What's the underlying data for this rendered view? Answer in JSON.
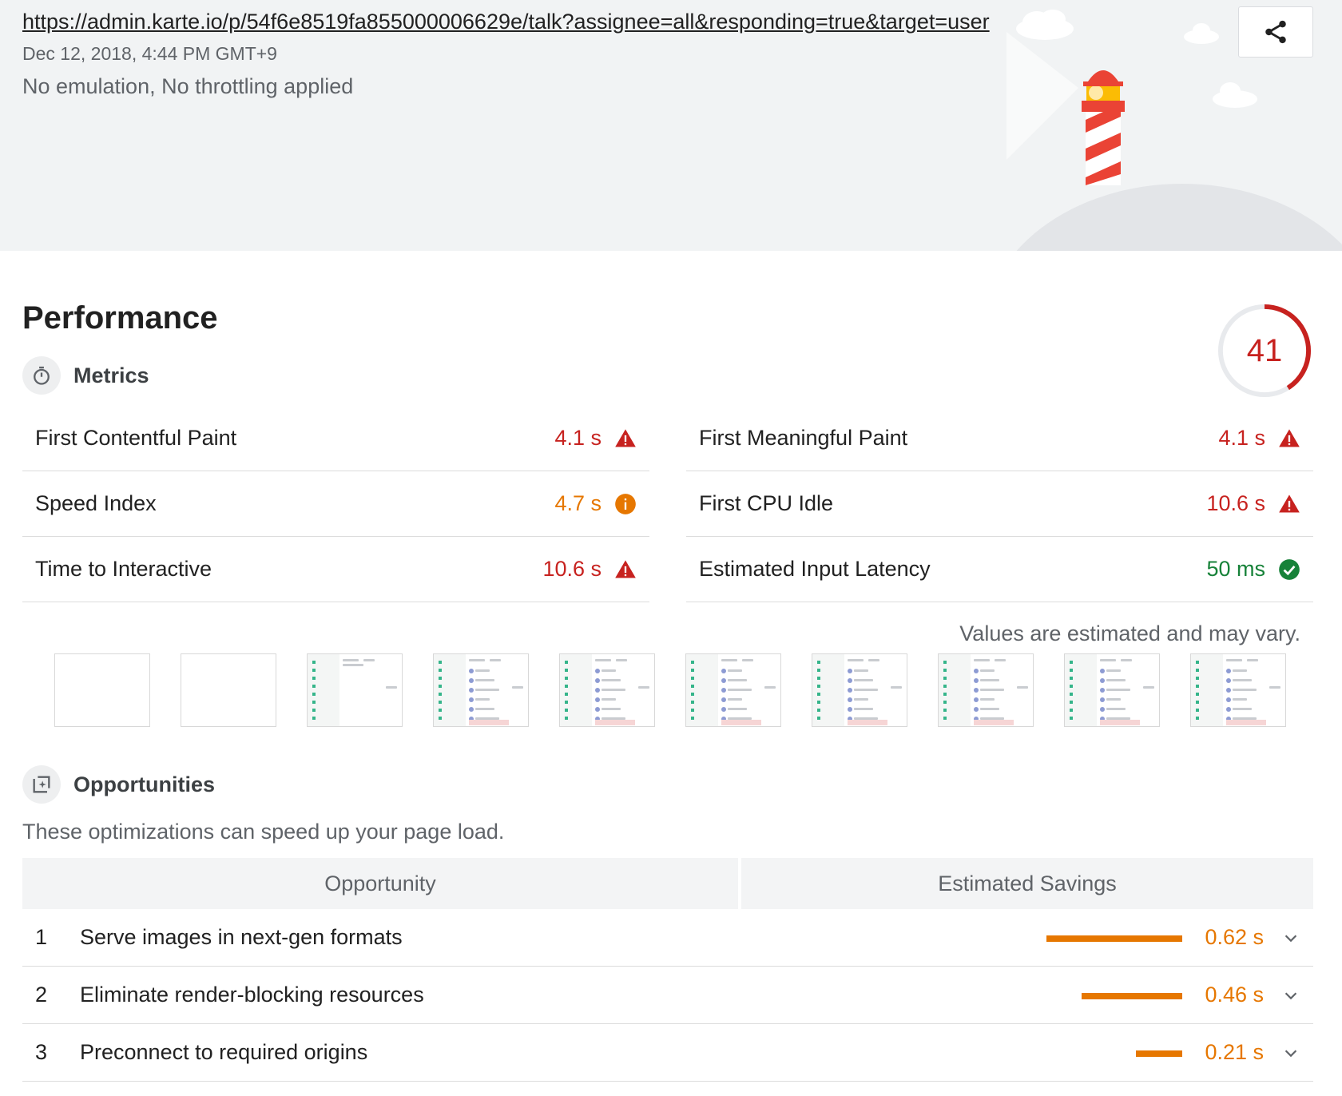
{
  "header": {
    "url": "https://admin.karte.io/p/54f6e8519fa855000006629e/talk?assignee=all&responding=true&target=user",
    "date": "Dec 12, 2018, 4:44 PM GMT+9",
    "environment": "No emulation, No throttling applied",
    "share_icon": "share-icon"
  },
  "performance": {
    "title": "Performance",
    "score": "41",
    "score_fraction": 0.41,
    "score_color": "#c7221f"
  },
  "metrics": {
    "title": "Metrics",
    "icon": "stopwatch-icon",
    "items": [
      {
        "label": "First Contentful Paint",
        "value": "4.1 s",
        "status": "fail"
      },
      {
        "label": "First Meaningful Paint",
        "value": "4.1 s",
        "status": "fail"
      },
      {
        "label": "Speed Index",
        "value": "4.7 s",
        "status": "average"
      },
      {
        "label": "First CPU Idle",
        "value": "10.6 s",
        "status": "fail"
      },
      {
        "label": "Time to Interactive",
        "value": "10.6 s",
        "status": "fail"
      },
      {
        "label": "Estimated Input Latency",
        "value": "50 ms",
        "status": "pass"
      }
    ],
    "note": "Values are estimated and may vary."
  },
  "filmstrip": {
    "frames": [
      "blank",
      "blank",
      "partial",
      "loaded",
      "loaded",
      "loaded",
      "loaded",
      "loaded",
      "loaded",
      "loaded"
    ]
  },
  "opportunities": {
    "title": "Opportunities",
    "icon": "opportunity-icon",
    "description": "These optimizations can speed up your page load.",
    "col_opportunity": "Opportunity",
    "col_savings": "Estimated Savings",
    "items": [
      {
        "num": "1",
        "title": "Serve images in next-gen formats",
        "savings": "0.62 s",
        "seconds": 0.62
      },
      {
        "num": "2",
        "title": "Eliminate render-blocking resources",
        "savings": "0.46 s",
        "seconds": 0.46
      },
      {
        "num": "3",
        "title": "Preconnect to required origins",
        "savings": "0.21 s",
        "seconds": 0.21
      }
    ]
  },
  "colors": {
    "fail": "#c7221f",
    "average": "#e67700",
    "pass": "#178239"
  }
}
